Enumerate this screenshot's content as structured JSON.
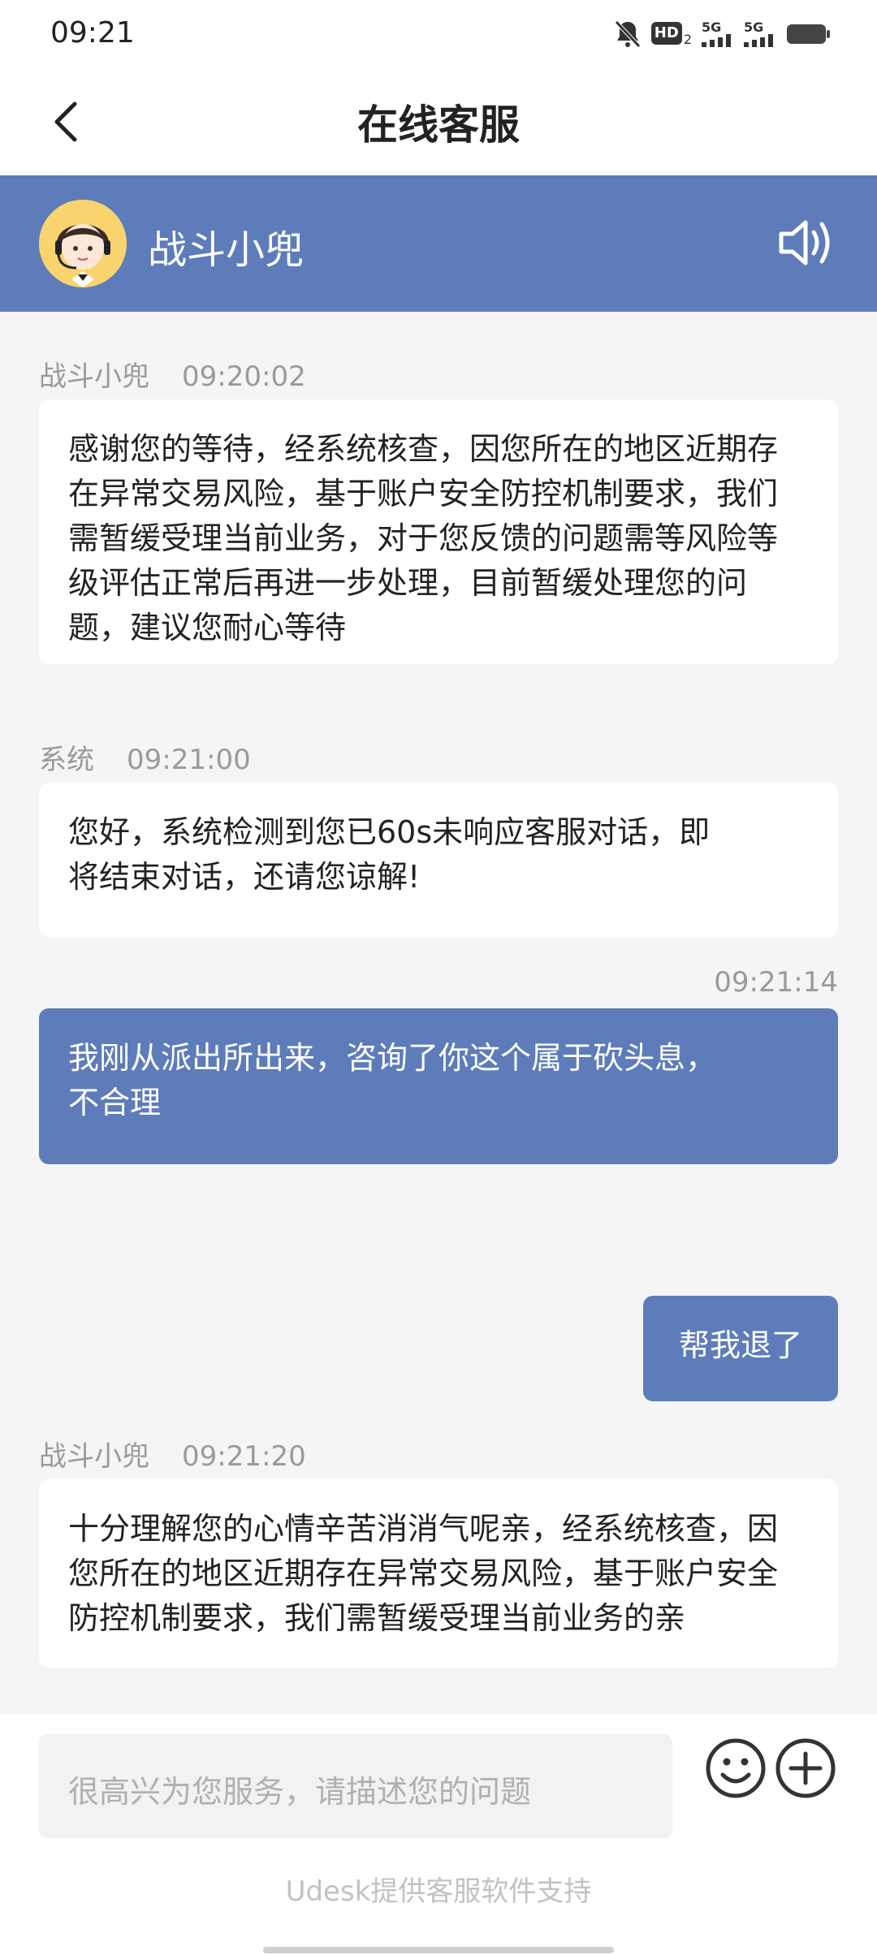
{
  "status": {
    "time": "09:21",
    "icons": [
      "bell-muted-icon",
      "hd-icon",
      "signal-5g-icon",
      "signal-5g-icon",
      "battery-icon"
    ],
    "hd_label": "HD",
    "hd_sub": "2",
    "net1": "5G",
    "net2": "5G"
  },
  "nav": {
    "title": "在线客服",
    "back_icon": "chevron-left-icon"
  },
  "agent": {
    "name": "战斗小兜",
    "speaker_icon": "speaker-icon"
  },
  "messages": [
    {
      "sender": "战斗小兜",
      "time": "09:20:02",
      "text": "感谢您的等待，经系统核查，因您所在的地区近期存\n在异常交易风险，基于账户安全防控机制要求，我们\n需暂缓受理当前业务，对于您反馈的问题需等风险等\n级评估正常后再进一步处理，目前暂缓处理您的问\n题，建议您耐心等待"
    },
    {
      "sender": "系统",
      "time": "09:21:00",
      "text": "您好，系统检测到您已60s未响应客服对话，即\n将结束对话，还请您谅解!"
    },
    {
      "time": "09:21:14",
      "text": "我刚从派出所出来，咨询了你这个属于砍头息，\n不合理"
    },
    {
      "text": "帮我退了"
    },
    {
      "sender": "战斗小兜",
      "time": "09:21:20",
      "text": "十分理解您的心情辛苦消消气呢亲，经系统核查，因\n您所在的地区近期存在异常交易风险，基于账户安全\n防控机制要求，我们需暂缓受理当前业务的亲"
    }
  ],
  "input": {
    "placeholder": "很高兴为您服务，请描述您的问题"
  },
  "footer": {
    "text": "Udesk提供客服软件支持"
  },
  "colors": {
    "accent": "#5e7cba",
    "background": "#f5f5f5"
  }
}
